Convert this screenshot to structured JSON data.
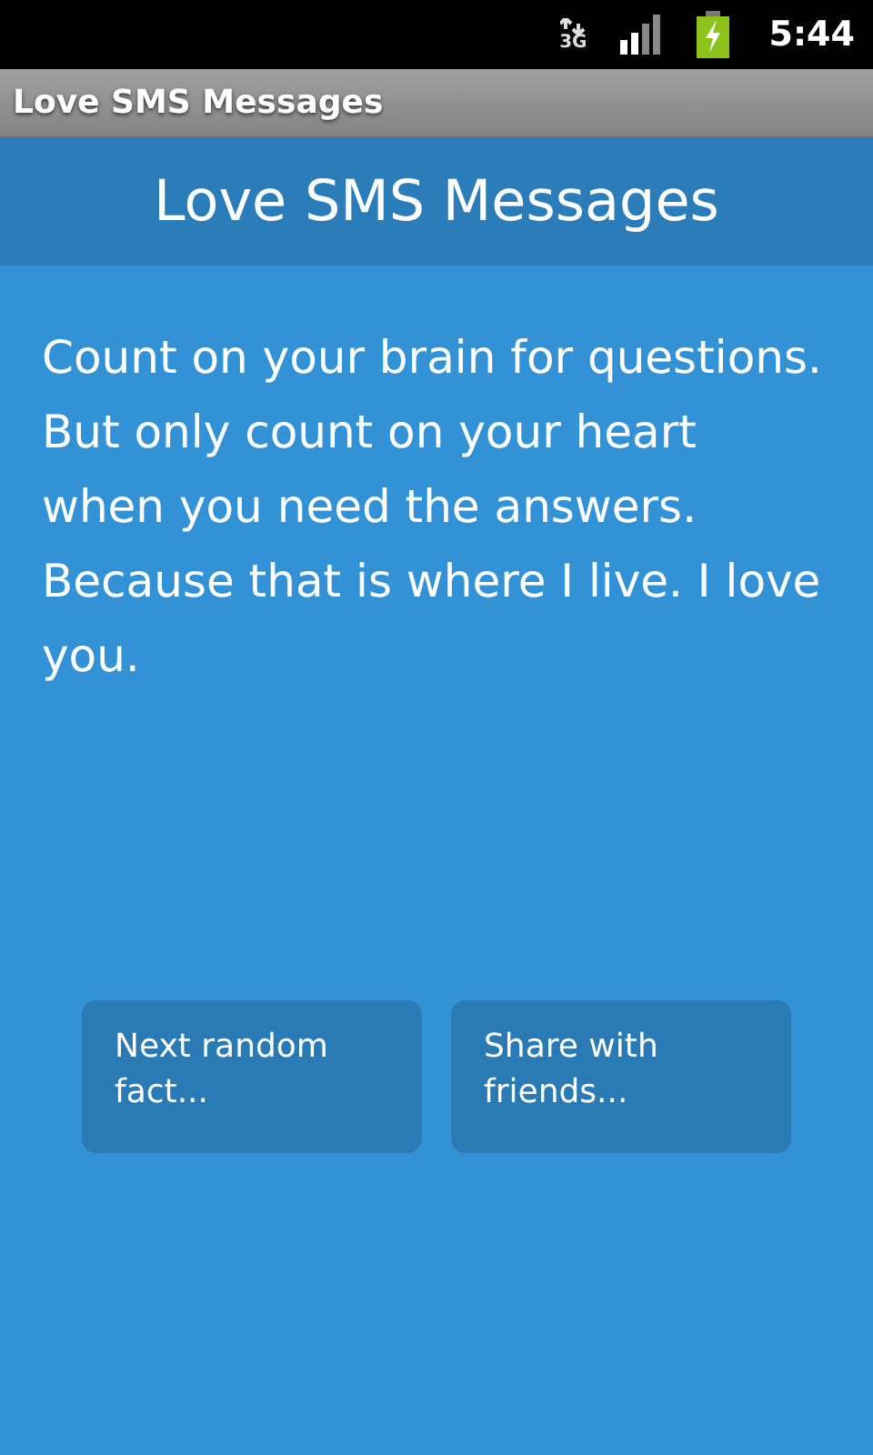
{
  "status_bar": {
    "network": "3G",
    "time": "5:44"
  },
  "window": {
    "title": "Love SMS Messages"
  },
  "header": {
    "title": "Love SMS Messages"
  },
  "message": "Count on your brain for questions. But only count on your heart when you need the answers. Because that is where I live. I love you.",
  "buttons": [
    {
      "label": "Next random fact..."
    },
    {
      "label": "Share with friends..."
    }
  ]
}
